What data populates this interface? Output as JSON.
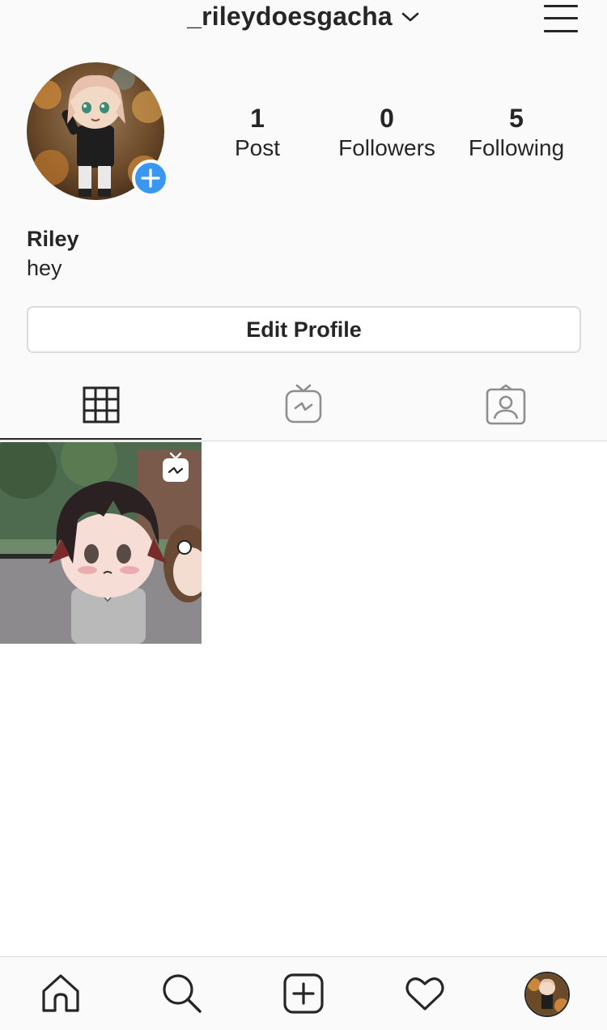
{
  "header": {
    "username": "_rileydoesgacha"
  },
  "stats": {
    "posts": {
      "count": "1",
      "label": "Post"
    },
    "followers": {
      "count": "0",
      "label": "Followers"
    },
    "following": {
      "count": "5",
      "label": "Following"
    }
  },
  "profile": {
    "name": "Riley",
    "bio": "hey",
    "edit_button": "Edit Profile"
  },
  "tabs": [
    {
      "icon": "grid-icon",
      "active": true
    },
    {
      "icon": "igtv-icon",
      "active": false
    },
    {
      "icon": "tagged-icon",
      "active": false
    }
  ],
  "posts": [
    {
      "type": "igtv-video"
    }
  ],
  "bottom_nav": [
    "home-icon",
    "search-icon",
    "new-post-icon",
    "activity-heart-icon",
    "profile-avatar"
  ],
  "colors": {
    "accent": "#3897f0",
    "text": "#262626",
    "border": "#dbdbdb",
    "background": "#fafafa"
  }
}
